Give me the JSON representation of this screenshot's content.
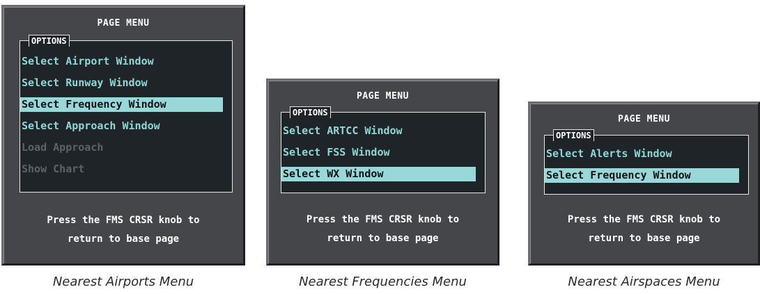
{
  "menus": [
    {
      "title": "PAGE MENU",
      "options_label": "OPTIONS",
      "items": [
        {
          "label": "Select Airport Window",
          "state": "normal"
        },
        {
          "label": "Select Runway Window",
          "state": "normal"
        },
        {
          "label": "Select Frequency Window",
          "state": "selected"
        },
        {
          "label": "Select Approach Window",
          "state": "normal"
        },
        {
          "label": "Load Approach",
          "state": "disabled"
        },
        {
          "label": "Show Chart",
          "state": "disabled"
        }
      ],
      "footer_line1": "Press the FMS CRSR knob to",
      "footer_line2": "return to base page",
      "caption": "Nearest Airports Menu"
    },
    {
      "title": "PAGE MENU",
      "options_label": "OPTIONS",
      "items": [
        {
          "label": "Select ARTCC Window",
          "state": "normal"
        },
        {
          "label": "Select FSS Window",
          "state": "normal"
        },
        {
          "label": "Select WX Window",
          "state": "selected"
        }
      ],
      "footer_line1": "Press the FMS CRSR knob to",
      "footer_line2": "return to base page",
      "caption": "Nearest Frequencies Menu"
    },
    {
      "title": "PAGE MENU",
      "options_label": "OPTIONS",
      "items": [
        {
          "label": "Select Alerts Window",
          "state": "normal"
        },
        {
          "label": "Select Frequency Window",
          "state": "selected"
        }
      ],
      "footer_line1": "Press the FMS CRSR knob to",
      "footer_line2": "return to base page",
      "caption": "Nearest Airspaces Menu"
    }
  ],
  "colors": {
    "panel": "#444649",
    "options_bg": "#1f2428",
    "item_text": "#8fd6d6",
    "selected_bg": "#9ad7d9",
    "disabled_text": "#5d6266"
  }
}
